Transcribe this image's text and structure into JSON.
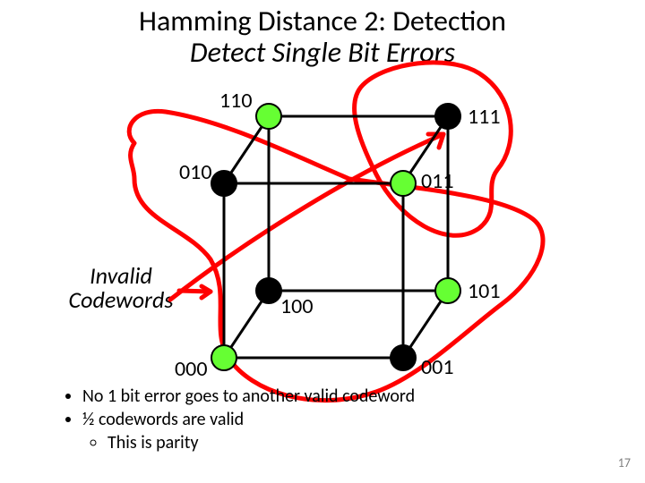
{
  "title": {
    "line1": "Hamming Distance 2: Detection",
    "line2": "Detect Single Bit Errors"
  },
  "side_label": "Invalid Codewords",
  "cube": {
    "labels": {
      "n110": "110",
      "n111": "111",
      "n010": "010",
      "n011": "011",
      "n100": "100",
      "n101": "101",
      "n000": "000",
      "n001": "001"
    }
  },
  "bullets": {
    "b1": "No 1 bit error goes to another valid codeword",
    "b2": "½ codewords are valid",
    "b2a": "This is parity"
  },
  "page_number": "17"
}
